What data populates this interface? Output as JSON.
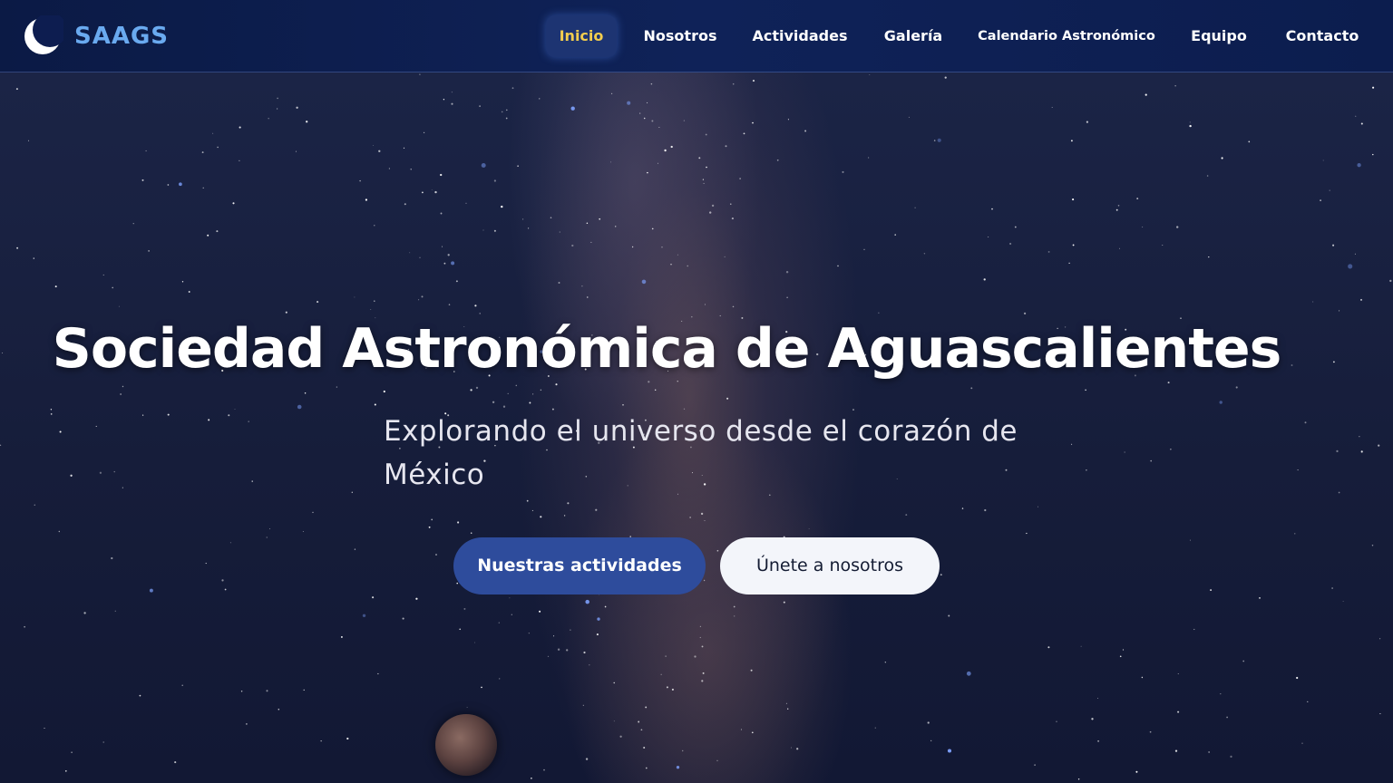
{
  "brand": {
    "logo_icon": "crescent-moon-icon",
    "name": "SAAGS",
    "color": "#6aaaf0"
  },
  "nav": {
    "items": [
      {
        "label": "Inicio",
        "active": true
      },
      {
        "label": "Nosotros",
        "active": false
      },
      {
        "label": "Actividades",
        "active": false
      },
      {
        "label": "Galería",
        "active": false
      },
      {
        "label": "Calendario Astronómico",
        "active": false
      },
      {
        "label": "Equipo",
        "active": false
      },
      {
        "label": "Contacto",
        "active": false
      }
    ],
    "active_color": "#f2cd4e"
  },
  "hero": {
    "title": "Sociedad Astronómica de Aguascalientes",
    "subtitle_line1": "Explorando el universo desde el corazón de",
    "subtitle_line2": "México",
    "primary_button": "Nuestras actividades",
    "secondary_button": "Únete a nosotros",
    "primary_color": "#2e4c9c"
  }
}
